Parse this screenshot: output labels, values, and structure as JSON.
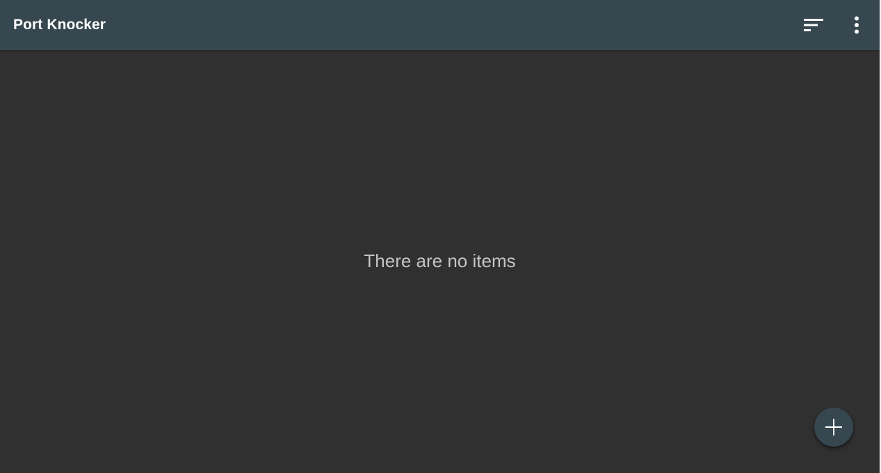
{
  "app_bar": {
    "title": "Port Knocker",
    "background_color": "#37474f",
    "actions": [
      {
        "icon": "sort-icon"
      },
      {
        "icon": "more-vert-icon"
      }
    ]
  },
  "main": {
    "background_color": "#303030",
    "empty_message": "There are no items"
  },
  "fab": {
    "icon": "add-icon",
    "background_color": "#37474f"
  }
}
